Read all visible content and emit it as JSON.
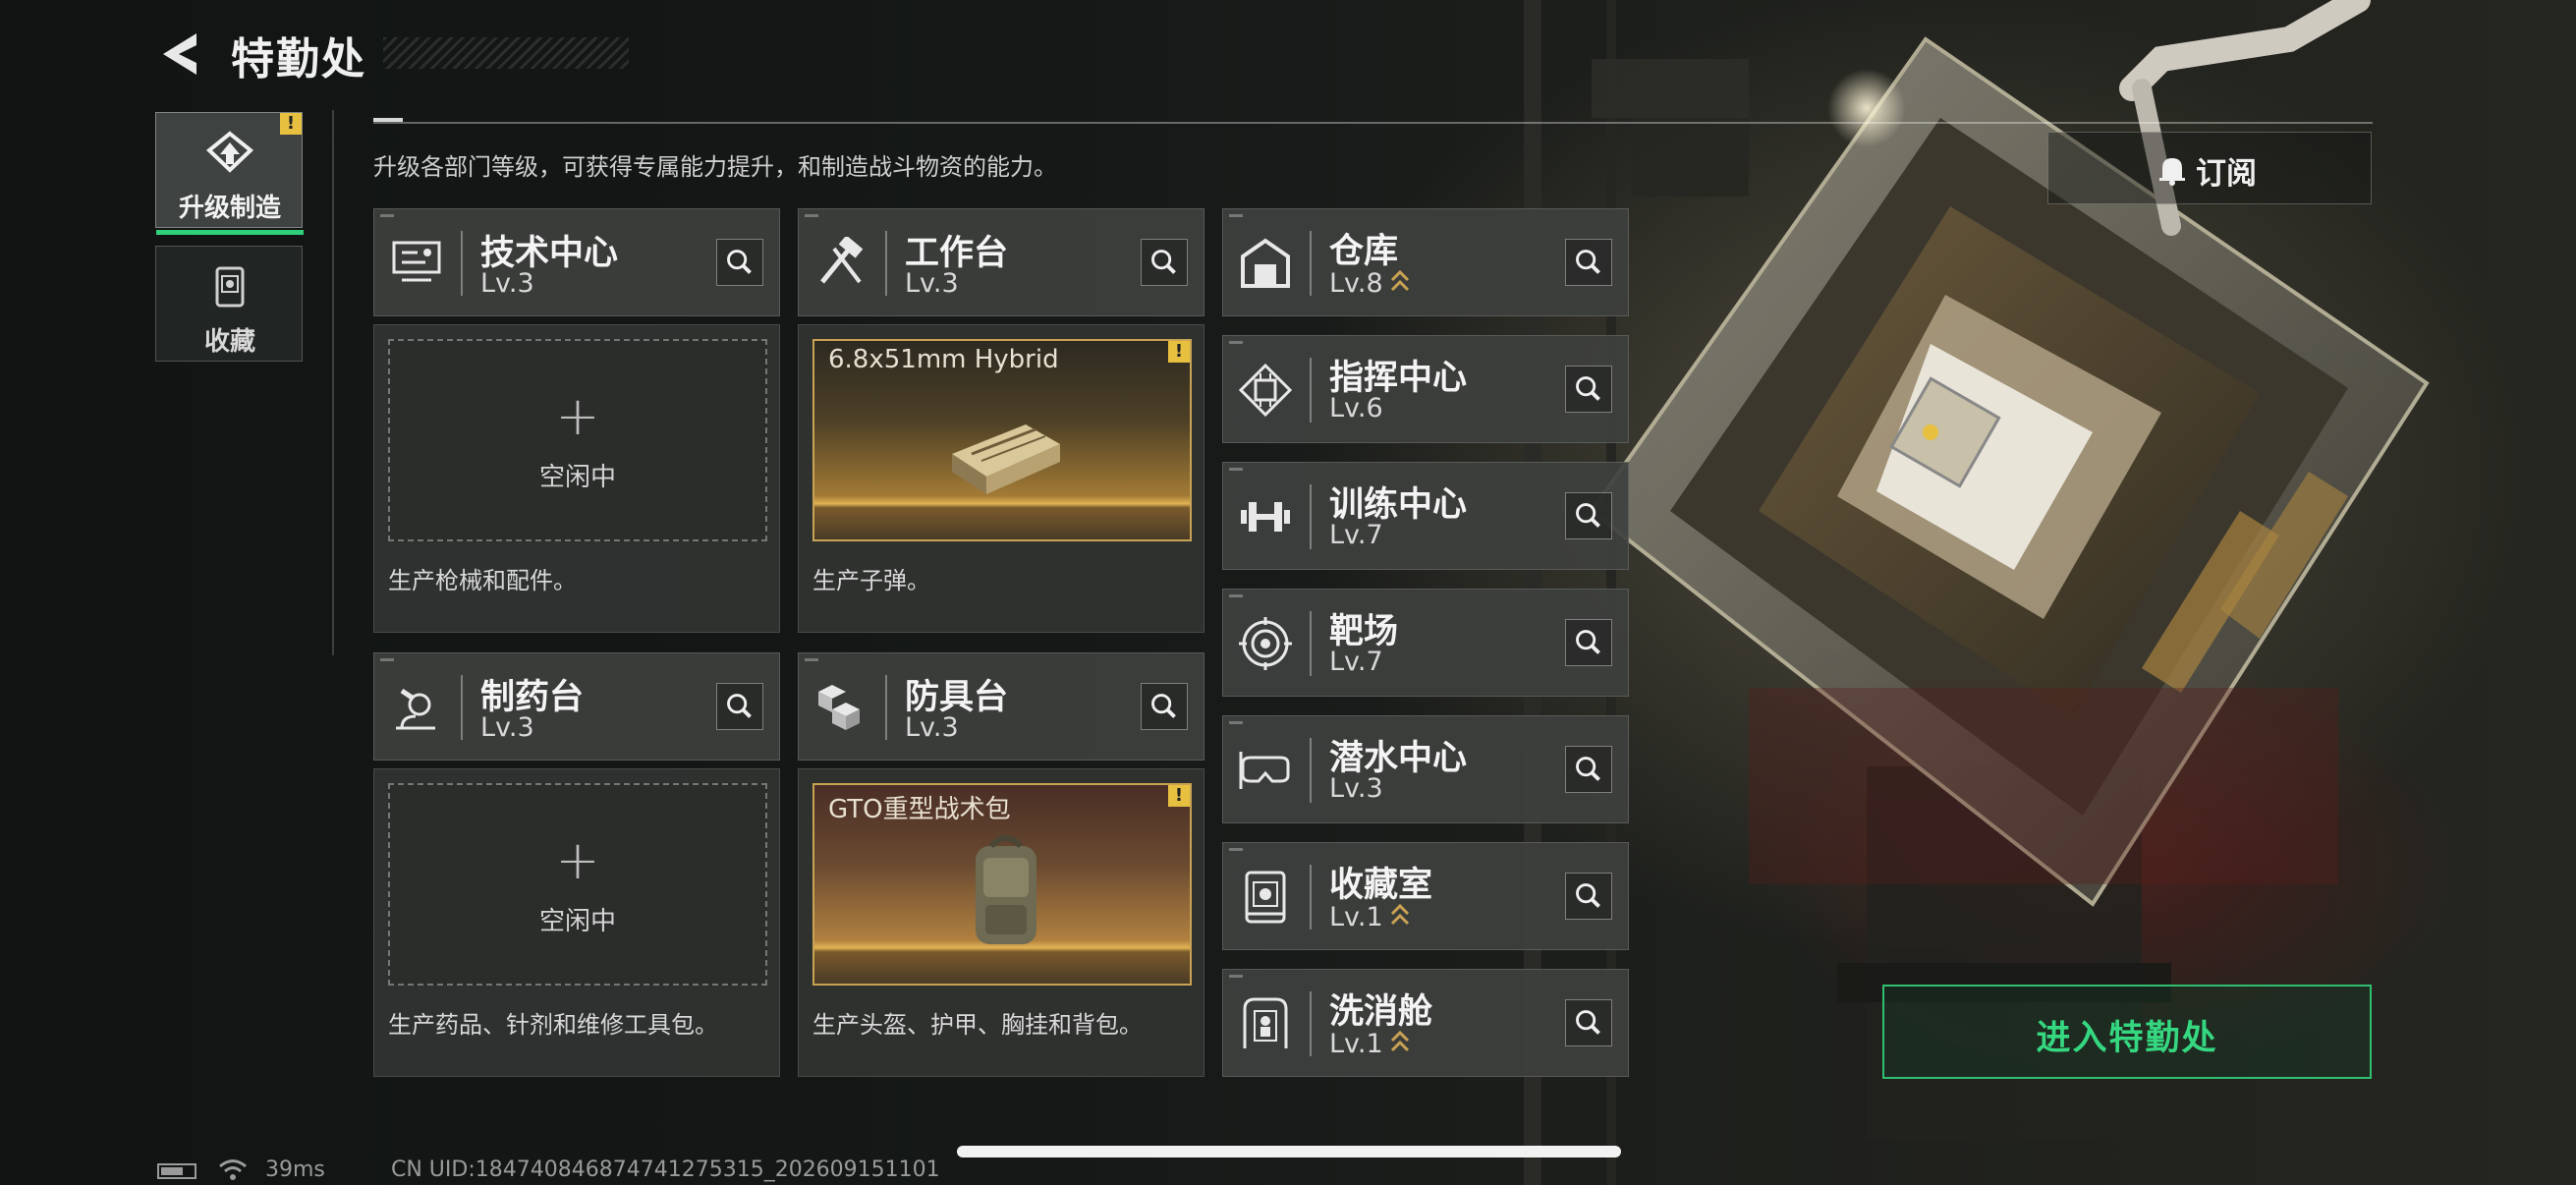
{
  "header": {
    "title": "特勤处",
    "back_icon": "back-arrow-icon",
    "subtitle": "升级各部门等级，可获得专属能力提升，和制造战斗物资的能力。"
  },
  "nav": {
    "tabs": [
      {
        "label": "升级制造",
        "icon": "upgrade-craft-icon",
        "active": true,
        "alert": "!"
      },
      {
        "label": "收藏",
        "icon": "collection-icon",
        "active": false
      }
    ]
  },
  "workshops": [
    {
      "name": "技术中心",
      "level": "Lv.3",
      "icon": "tech-center-icon",
      "slot_state": "empty",
      "plus": "+",
      "slot_status": "空闲中",
      "description": "生产枪械和配件。"
    },
    {
      "name": "工作台",
      "level": "Lv.3",
      "icon": "workbench-icon",
      "slot_state": "item",
      "item_name": "6.8x51mm Hybrid",
      "alert": "!",
      "description": "生产子弹。"
    },
    {
      "name": "制药台",
      "level": "Lv.3",
      "icon": "pharmacy-icon",
      "slot_state": "empty",
      "plus": "+",
      "slot_status": "空闲中",
      "description": "生产药品、针剂和维修工具包。"
    },
    {
      "name": "防具台",
      "level": "Lv.3",
      "icon": "armor-bench-icon",
      "slot_state": "item",
      "item_name": "GTO重型战术包",
      "alert": "!",
      "description": "生产头盔、护甲、胸挂和背包。"
    }
  ],
  "departments": [
    {
      "name": "仓库",
      "level": "Lv.8",
      "icon": "warehouse-icon",
      "upgradable": true
    },
    {
      "name": "指挥中心",
      "level": "Lv.6",
      "icon": "command-center-icon",
      "upgradable": false
    },
    {
      "name": "训练中心",
      "level": "Lv.7",
      "icon": "training-center-icon",
      "upgradable": false
    },
    {
      "name": "靶场",
      "level": "Lv.7",
      "icon": "shooting-range-icon",
      "upgradable": false
    },
    {
      "name": "潜水中心",
      "level": "Lv.3",
      "icon": "diving-center-icon",
      "upgradable": false
    },
    {
      "name": "收藏室",
      "level": "Lv.1",
      "icon": "collection-room-icon",
      "upgradable": true
    },
    {
      "name": "洗消舱",
      "level": "Lv.1",
      "icon": "decon-chamber-icon",
      "upgradable": true
    }
  ],
  "subscribe": {
    "label": "订阅",
    "icon": "bell-icon"
  },
  "enter_button": {
    "label": "进入特勤处"
  },
  "status_bar": {
    "ping": "39ms",
    "uid": "CN UID:1847408468747412753​15_202609151101"
  },
  "colors": {
    "accent_green": "#2fd07a",
    "alert_yellow": "#e8c040",
    "gold": "#c9a254"
  }
}
